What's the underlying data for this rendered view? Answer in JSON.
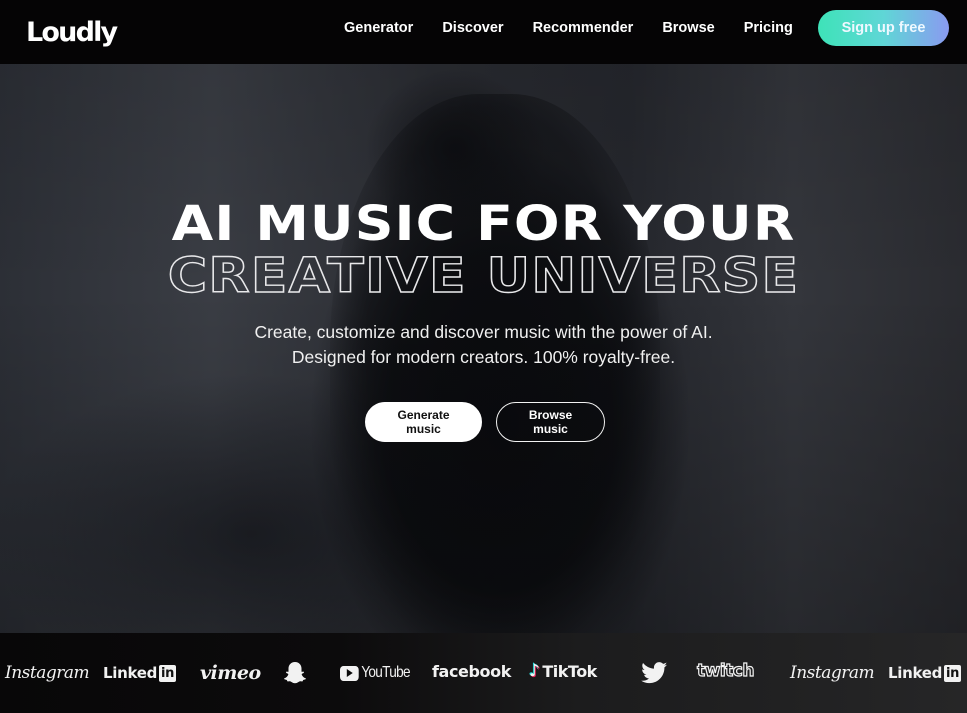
{
  "header": {
    "logo": "Loudly",
    "nav": [
      "Generator",
      "Discover",
      "Recommender",
      "Browse",
      "Pricing"
    ],
    "signup_label": "Sign up free",
    "signup_gradient": [
      "#3ee3b8",
      "#8a9af0"
    ]
  },
  "hero": {
    "headline_line1": "AI MUSIC FOR YOUR",
    "headline_line2": "CREATIVE UNIVERSE",
    "subtitle_line1": "Create, customize and discover music with the power of AI.",
    "subtitle_line2": "Designed for modern creators. 100% royalty-free.",
    "primary_cta": "Generate music",
    "secondary_cta": "Browse music"
  },
  "logos": {
    "items": [
      {
        "name": "Instagram",
        "label": "Instagram",
        "icon": "instagram-wordmark"
      },
      {
        "name": "LinkedIn",
        "label": "Linked",
        "badge": "in",
        "icon": "linkedin-wordmark"
      },
      {
        "name": "Vimeo",
        "label": "vimeo",
        "icon": "vimeo-wordmark"
      },
      {
        "name": "Snapchat",
        "label": "",
        "icon": "snapchat-ghost-icon"
      },
      {
        "name": "YouTube",
        "label": "YouTube",
        "icon": "youtube-wordmark"
      },
      {
        "name": "Facebook",
        "label": "facebook",
        "icon": "facebook-wordmark"
      },
      {
        "name": "TikTok",
        "label": "TikTok",
        "glyph": "♪",
        "icon": "tiktok-wordmark"
      },
      {
        "name": "Twitter",
        "label": "",
        "icon": "twitter-bird-icon"
      },
      {
        "name": "Twitch",
        "label": "twitch",
        "icon": "twitch-wordmark"
      },
      {
        "name": "Instagram",
        "label": "Instagram",
        "icon": "instagram-wordmark"
      },
      {
        "name": "LinkedIn",
        "label": "Linked",
        "badge": "in",
        "icon": "linkedin-wordmark"
      }
    ]
  }
}
